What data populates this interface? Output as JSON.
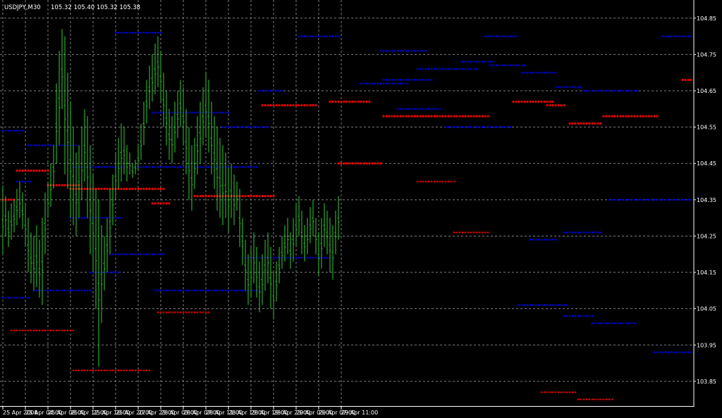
{
  "header": {
    "symbol_timeframe": "USDJPY,M30",
    "ohlc": "105.32 105.40 105.32 105.38"
  },
  "colors": {
    "background": "#000000",
    "grid": "#7f7f7f",
    "axis": "#ffffff",
    "bar": "#33cc33",
    "level_blue": "#0000ff",
    "level_red": "#ff0000"
  },
  "chart_data": {
    "type": "bar",
    "grid": true,
    "ylim": [
      103.78,
      104.9
    ],
    "y_ticks": [
      "104.85",
      "104.75",
      "104.65",
      "104.55",
      "104.45",
      "104.35",
      "104.25",
      "104.15",
      "104.05",
      "103.95",
      "103.85"
    ],
    "y_tick_values": [
      104.85,
      104.75,
      104.65,
      104.55,
      104.45,
      104.35,
      104.25,
      104.15,
      104.05,
      103.95,
      103.85
    ],
    "x_ticks": [
      "25 Apr 2008",
      "25 Apr 04:00",
      "25 Apr 08:00",
      "25 Apr 12:00",
      "25 Apr 16:00",
      "25 Apr 20:00",
      "27 Apr 23:00",
      "28 Apr 03:00",
      "28 Apr 07:00",
      "28 Apr 11:00",
      "28 Apr 15:00",
      "28 Apr 19:00",
      "28 Apr 23:00",
      "29 Apr 03:00",
      "29 Apr 07:00",
      "29 Apr 11:00"
    ],
    "x_tick_bar_index": [
      0,
      8,
      16,
      24,
      32,
      40,
      48,
      56,
      64,
      72,
      80,
      88,
      96,
      104,
      112,
      120
    ],
    "bars": [
      {
        "h": 104.39,
        "l": 104.2
      },
      {
        "h": 104.36,
        "l": 104.25
      },
      {
        "h": 104.32,
        "l": 104.22
      },
      {
        "h": 104.34,
        "l": 104.24
      },
      {
        "h": 104.35,
        "l": 104.26
      },
      {
        "h": 104.38,
        "l": 104.28
      },
      {
        "h": 104.4,
        "l": 104.3
      },
      {
        "h": 104.37,
        "l": 104.27
      },
      {
        "h": 104.34,
        "l": 104.22
      },
      {
        "h": 104.3,
        "l": 104.15
      },
      {
        "h": 104.26,
        "l": 104.12
      },
      {
        "h": 104.25,
        "l": 104.1
      },
      {
        "h": 104.28,
        "l": 104.11
      },
      {
        "h": 104.24,
        "l": 104.08
      },
      {
        "h": 104.3,
        "l": 104.06
      },
      {
        "h": 104.37,
        "l": 104.2
      },
      {
        "h": 104.4,
        "l": 104.3
      },
      {
        "h": 104.45,
        "l": 104.33
      },
      {
        "h": 104.5,
        "l": 104.38
      },
      {
        "h": 104.67,
        "l": 104.45
      },
      {
        "h": 104.76,
        "l": 104.5
      },
      {
        "h": 104.82,
        "l": 104.6
      },
      {
        "h": 104.8,
        "l": 104.42
      },
      {
        "h": 104.7,
        "l": 104.38
      },
      {
        "h": 104.62,
        "l": 104.3
      },
      {
        "h": 104.55,
        "l": 104.28
      },
      {
        "h": 104.48,
        "l": 104.25
      },
      {
        "h": 104.5,
        "l": 104.3
      },
      {
        "h": 104.55,
        "l": 104.35
      },
      {
        "h": 104.6,
        "l": 104.4
      },
      {
        "h": 104.58,
        "l": 104.3
      },
      {
        "h": 104.5,
        "l": 104.2
      },
      {
        "h": 104.42,
        "l": 104.15
      },
      {
        "h": 104.38,
        "l": 104.05
      },
      {
        "h": 104.35,
        "l": 103.89
      },
      {
        "h": 104.28,
        "l": 104.01
      },
      {
        "h": 104.25,
        "l": 104.1
      },
      {
        "h": 104.3,
        "l": 104.15
      },
      {
        "h": 104.38,
        "l": 104.2
      },
      {
        "h": 104.42,
        "l": 104.28
      },
      {
        "h": 104.48,
        "l": 104.35
      },
      {
        "h": 104.52,
        "l": 104.38
      },
      {
        "h": 104.56,
        "l": 104.4
      },
      {
        "h": 104.55,
        "l": 104.42
      },
      {
        "h": 104.5,
        "l": 104.4
      },
      {
        "h": 104.48,
        "l": 104.42
      },
      {
        "h": 104.45,
        "l": 104.41
      },
      {
        "h": 104.46,
        "l": 104.42
      },
      {
        "h": 104.5,
        "l": 104.43
      },
      {
        "h": 104.56,
        "l": 104.46
      },
      {
        "h": 104.62,
        "l": 104.5
      },
      {
        "h": 104.68,
        "l": 104.56
      },
      {
        "h": 104.72,
        "l": 104.6
      },
      {
        "h": 104.75,
        "l": 104.62
      },
      {
        "h": 104.78,
        "l": 104.64
      },
      {
        "h": 104.8,
        "l": 104.66
      },
      {
        "h": 104.76,
        "l": 104.62
      },
      {
        "h": 104.7,
        "l": 104.55
      },
      {
        "h": 104.65,
        "l": 104.5
      },
      {
        "h": 104.6,
        "l": 104.46
      },
      {
        "h": 104.58,
        "l": 104.45
      },
      {
        "h": 104.62,
        "l": 104.48
      },
      {
        "h": 104.65,
        "l": 104.52
      },
      {
        "h": 104.68,
        "l": 104.55
      },
      {
        "h": 104.66,
        "l": 104.5
      },
      {
        "h": 104.6,
        "l": 104.42
      },
      {
        "h": 104.55,
        "l": 104.35
      },
      {
        "h": 104.5,
        "l": 104.32
      },
      {
        "h": 104.52,
        "l": 104.38
      },
      {
        "h": 104.58,
        "l": 104.42
      },
      {
        "h": 104.62,
        "l": 104.45
      },
      {
        "h": 104.66,
        "l": 104.5
      },
      {
        "h": 104.7,
        "l": 104.52
      },
      {
        "h": 104.68,
        "l": 104.48
      },
      {
        "h": 104.62,
        "l": 104.42
      },
      {
        "h": 104.58,
        "l": 104.38
      },
      {
        "h": 104.55,
        "l": 104.32
      },
      {
        "h": 104.52,
        "l": 104.3
      },
      {
        "h": 104.5,
        "l": 104.28
      },
      {
        "h": 104.48,
        "l": 104.3
      },
      {
        "h": 104.44,
        "l": 104.26
      },
      {
        "h": 104.45,
        "l": 104.3
      },
      {
        "h": 104.42,
        "l": 104.28
      },
      {
        "h": 104.4,
        "l": 104.32
      },
      {
        "h": 104.38,
        "l": 104.22
      },
      {
        "h": 104.3,
        "l": 104.17
      },
      {
        "h": 104.24,
        "l": 104.1
      },
      {
        "h": 104.2,
        "l": 104.06
      },
      {
        "h": 104.22,
        "l": 104.08
      },
      {
        "h": 104.26,
        "l": 104.12
      },
      {
        "h": 104.22,
        "l": 104.08
      },
      {
        "h": 104.18,
        "l": 104.04
      },
      {
        "h": 104.2,
        "l": 104.06
      },
      {
        "h": 104.24,
        "l": 104.1
      },
      {
        "h": 104.26,
        "l": 104.12
      },
      {
        "h": 104.22,
        "l": 104.05
      },
      {
        "h": 104.15,
        "l": 104.02
      },
      {
        "h": 104.18,
        "l": 104.07
      },
      {
        "h": 104.22,
        "l": 104.12
      },
      {
        "h": 104.25,
        "l": 104.16
      },
      {
        "h": 104.28,
        "l": 104.18
      },
      {
        "h": 104.3,
        "l": 104.2
      },
      {
        "h": 104.26,
        "l": 104.16
      },
      {
        "h": 104.3,
        "l": 104.18
      },
      {
        "h": 104.34,
        "l": 104.22
      },
      {
        "h": 104.36,
        "l": 104.25
      },
      {
        "h": 104.32,
        "l": 104.2
      },
      {
        "h": 104.28,
        "l": 104.18
      },
      {
        "h": 104.3,
        "l": 104.2
      },
      {
        "h": 104.33,
        "l": 104.23
      },
      {
        "h": 104.35,
        "l": 104.25
      },
      {
        "h": 104.3,
        "l": 104.2
      },
      {
        "h": 104.26,
        "l": 104.14
      },
      {
        "h": 104.3,
        "l": 104.16
      },
      {
        "h": 104.34,
        "l": 104.22
      },
      {
        "h": 104.32,
        "l": 104.2
      },
      {
        "h": 104.3,
        "l": 104.15
      },
      {
        "h": 104.28,
        "l": 104.13
      },
      {
        "h": 104.32,
        "l": 104.2
      },
      {
        "h": 104.36,
        "l": 104.24
      }
    ],
    "levels": [
      {
        "c": "blue",
        "s": "+",
        "y": 104.54,
        "x0": 0,
        "x1": 7
      },
      {
        "c": "red",
        "s": "*",
        "y": 104.35,
        "x0": 0,
        "x1": 4
      },
      {
        "c": "blue",
        "s": "+",
        "y": 104.08,
        "x0": 0,
        "x1": 9
      },
      {
        "c": "red",
        "s": "*",
        "y": 104.43,
        "x0": 5,
        "x1": 16
      },
      {
        "c": "blue",
        "s": "+",
        "y": 104.4,
        "x0": 5,
        "x1": 10
      },
      {
        "c": "red",
        "s": "+",
        "y": 103.99,
        "x0": 3,
        "x1": 25
      },
      {
        "c": "blue",
        "s": "+",
        "y": 104.5,
        "x0": 9,
        "x1": 26
      },
      {
        "c": "red",
        "s": "*",
        "y": 104.39,
        "x0": 16,
        "x1": 27
      },
      {
        "c": "blue",
        "s": "+",
        "y": 104.1,
        "x0": 11,
        "x1": 31
      },
      {
        "c": "blue",
        "s": "+",
        "y": 104.15,
        "x0": 31,
        "x1": 41
      },
      {
        "c": "blue",
        "s": "+",
        "y": 104.44,
        "x0": 25,
        "x1": 43
      },
      {
        "c": "red",
        "s": "+",
        "y": 103.88,
        "x0": 25,
        "x1": 52
      },
      {
        "c": "red",
        "s": "*",
        "y": 104.38,
        "x0": 24,
        "x1": 57
      },
      {
        "c": "blue",
        "s": "+",
        "y": 104.3,
        "x0": 24,
        "x1": 42
      },
      {
        "c": "blue",
        "s": "+",
        "y": 104.81,
        "x0": 40,
        "x1": 56
      },
      {
        "c": "blue",
        "s": "+",
        "y": 104.2,
        "x0": 38,
        "x1": 57
      },
      {
        "c": "blue",
        "s": "+",
        "y": 104.44,
        "x0": 46,
        "x1": 66
      },
      {
        "c": "red",
        "s": "*",
        "y": 104.34,
        "x0": 53,
        "x1": 59
      },
      {
        "c": "blue",
        "s": "+",
        "y": 104.59,
        "x0": 53,
        "x1": 80
      },
      {
        "c": "red",
        "s": "+",
        "y": 104.04,
        "x0": 55,
        "x1": 73
      },
      {
        "c": "blue",
        "s": "+",
        "y": 104.1,
        "x0": 54,
        "x1": 91
      },
      {
        "c": "blue",
        "s": "+",
        "y": 104.19,
        "x0": 86,
        "x1": 116
      },
      {
        "c": "red",
        "s": "*",
        "y": 104.36,
        "x0": 68,
        "x1": 96
      },
      {
        "c": "blue",
        "s": "+",
        "y": 104.44,
        "x0": 68,
        "x1": 90
      },
      {
        "c": "blue",
        "s": "+",
        "y": 104.55,
        "x0": 78,
        "x1": 94
      },
      {
        "c": "red",
        "s": "*",
        "y": 104.61,
        "x0": 92,
        "x1": 111
      },
      {
        "c": "blue",
        "s": "+",
        "y": 104.65,
        "x0": 91,
        "x1": 99
      },
      {
        "c": "blue",
        "s": "+",
        "y": 104.8,
        "x0": 105,
        "x1": 119
      },
      {
        "c": "red",
        "s": "*",
        "y": 104.62,
        "x0": 116,
        "x1": 130
      },
      {
        "c": "blue",
        "s": "+",
        "y": 104.91,
        "x0": 118,
        "x1": 129
      },
      {
        "c": "red",
        "s": "*",
        "y": 104.45,
        "x0": 119,
        "x1": 134
      },
      {
        "c": "blue",
        "s": "+",
        "y": 104.67,
        "x0": 127,
        "x1": 143
      },
      {
        "c": "blue",
        "s": "+",
        "y": 104.68,
        "x0": 135,
        "x1": 152
      },
      {
        "c": "blue",
        "s": "+",
        "y": 104.76,
        "x0": 134,
        "x1": 150
      },
      {
        "c": "red",
        "s": "*",
        "y": 104.58,
        "x0": 135,
        "x1": 154
      },
      {
        "c": "blue",
        "s": "+",
        "y": 104.6,
        "x0": 140,
        "x1": 155
      },
      {
        "c": "red",
        "s": "+",
        "y": 104.4,
        "x0": 147,
        "x1": 160
      },
      {
        "c": "blue",
        "s": "+",
        "y": 104.71,
        "x0": 147,
        "x1": 168
      },
      {
        "c": "red",
        "s": "*",
        "y": 104.58,
        "x0": 145,
        "x1": 172
      },
      {
        "c": "blue",
        "s": "+",
        "y": 104.55,
        "x0": 157,
        "x1": 180
      },
      {
        "c": "red",
        "s": "+",
        "y": 104.26,
        "x0": 160,
        "x1": 172
      },
      {
        "c": "blue",
        "s": "+",
        "y": 104.73,
        "x0": 163,
        "x1": 174
      },
      {
        "c": "blue",
        "s": "+",
        "y": 104.8,
        "x0": 171,
        "x1": 182
      },
      {
        "c": "blue",
        "s": "+",
        "y": 104.72,
        "x0": 173,
        "x1": 185
      },
      {
        "c": "red",
        "s": "*",
        "y": 104.62,
        "x0": 181,
        "x1": 195
      },
      {
        "c": "blue",
        "s": "+",
        "y": 104.06,
        "x0": 183,
        "x1": 200
      },
      {
        "c": "red",
        "s": "+",
        "y": 103.82,
        "x0": 191,
        "x1": 203
      },
      {
        "c": "blue",
        "s": "+",
        "y": 104.7,
        "x0": 184,
        "x1": 196
      },
      {
        "c": "blue",
        "s": "+",
        "y": 104.24,
        "x0": 187,
        "x1": 196
      },
      {
        "c": "red",
        "s": "*",
        "y": 104.61,
        "x0": 193,
        "x1": 199
      },
      {
        "c": "blue",
        "s": "+",
        "y": 104.66,
        "x0": 196,
        "x1": 205
      },
      {
        "c": "blue",
        "s": "+",
        "y": 104.26,
        "x0": 199,
        "x1": 212
      },
      {
        "c": "blue",
        "s": "+",
        "y": 104.03,
        "x0": 199,
        "x1": 209
      },
      {
        "c": "red",
        "s": "*",
        "y": 104.56,
        "x0": 201,
        "x1": 212
      },
      {
        "c": "blue",
        "s": "+",
        "y": 104.65,
        "x0": 206,
        "x1": 225
      },
      {
        "c": "red",
        "s": "+",
        "y": 103.8,
        "x0": 204,
        "x1": 216
      },
      {
        "c": "blue",
        "s": "+",
        "y": 104.01,
        "x0": 209,
        "x1": 224
      },
      {
        "c": "red",
        "s": "*",
        "y": 104.58,
        "x0": 213,
        "x1": 232
      },
      {
        "c": "blue",
        "s": "+",
        "y": 104.35,
        "x0": 215,
        "x1": 245
      },
      {
        "c": "blue",
        "s": "+",
        "y": 103.93,
        "x0": 231,
        "x1": 245
      },
      {
        "c": "blue",
        "s": "+",
        "y": 104.8,
        "x0": 234,
        "x1": 245
      },
      {
        "c": "red",
        "s": "*",
        "y": 104.68,
        "x0": 241,
        "x1": 245
      }
    ]
  }
}
